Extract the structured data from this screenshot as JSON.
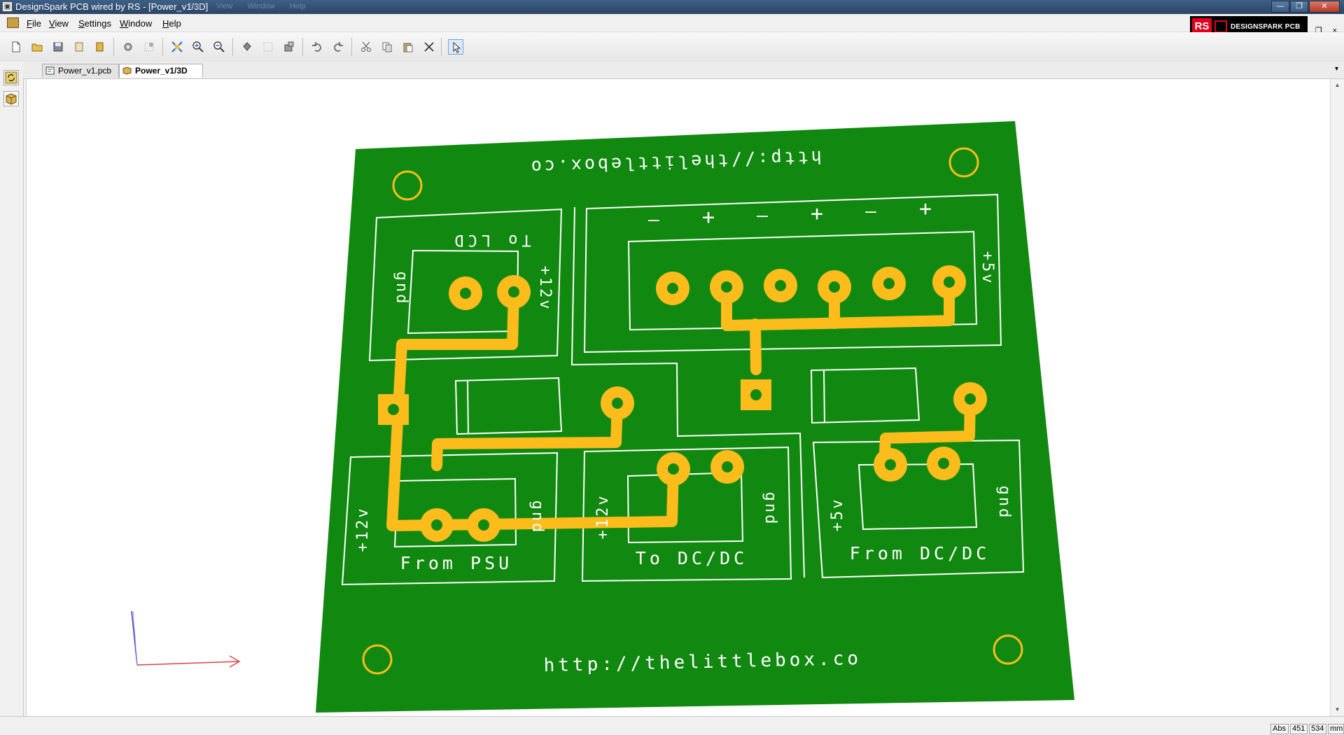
{
  "window": {
    "title": "DesignSpark PCB wired by RS - [Power_v1/3D]",
    "ghost_menu": [
      "File",
      "View",
      "Window",
      "Help"
    ],
    "buttons": {
      "minimize": "—",
      "restore": "❐",
      "close": "✕"
    }
  },
  "menu": {
    "items": [
      "File",
      "View",
      "Settings",
      "Window",
      "Help"
    ]
  },
  "brand": {
    "rs_label": "RS",
    "product_label": "DESIGNSPARK PCB",
    "color": "#e3001b"
  },
  "mdi_controls": "- ❐ ×",
  "toolbar": {
    "buttons": [
      "new-file",
      "open-folder",
      "save",
      "open-design",
      "open-library",
      "design-settings",
      "grid-settings",
      "zoom-extents",
      "zoom-in",
      "zoom-out",
      "fill",
      "grid",
      "component",
      "undo",
      "redo",
      "cut",
      "copy",
      "paste",
      "delete",
      "select"
    ]
  },
  "tabs": [
    {
      "label": "Power_v1.pcb",
      "active": false
    },
    {
      "label": "Power_v1/3D",
      "active": true
    }
  ],
  "board": {
    "colors": {
      "substrate": "#11880f",
      "copper": "#fbbc1c",
      "silkscreen": "#ffffff"
    },
    "top_url": "http://thelittlebox.co",
    "bottom_url": "http://thelittlebox.co",
    "lcd_connector": {
      "label": "To LCD",
      "pin1": "gnd",
      "pin2": "+12v"
    },
    "five_volt_header": {
      "label": "+5v",
      "signs": [
        "—",
        "+",
        "—",
        "+",
        "—",
        "+"
      ]
    },
    "psu_connector": {
      "label": "From PSU",
      "pin1": "+12v",
      "pin2": "gnd"
    },
    "to_dcdc_connector": {
      "label": "To DC/DC",
      "pin1": "+12v",
      "pin2": "gnd"
    },
    "from_dcdc_connector": {
      "label": "From DC/DC",
      "pin1": "+5v",
      "pin2": "gnd"
    }
  },
  "status": {
    "mode": "Abs",
    "x": "451",
    "y": "534",
    "units": "mm"
  }
}
